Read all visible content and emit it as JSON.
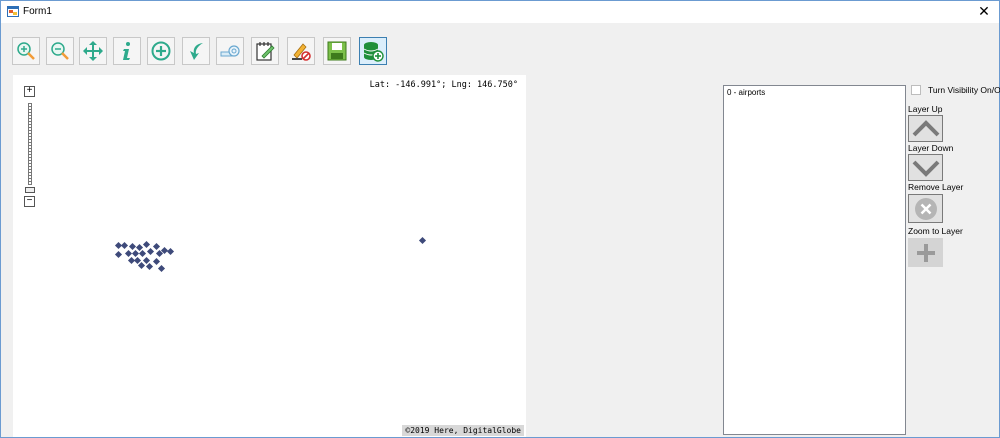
{
  "window": {
    "title": "Form1",
    "close_glyph": "✕"
  },
  "toolbar": {
    "buttons": [
      {
        "name": "zoom-in-icon"
      },
      {
        "name": "zoom-out-icon"
      },
      {
        "name": "pan-icon"
      },
      {
        "name": "info-icon"
      },
      {
        "name": "add-circle-icon"
      },
      {
        "name": "back-arrow-icon"
      },
      {
        "name": "measure-icon"
      },
      {
        "name": "edit-icon"
      },
      {
        "name": "clear-icon"
      },
      {
        "name": "save-icon"
      },
      {
        "name": "add-database-icon"
      }
    ]
  },
  "map": {
    "coordinates": "Lat: -146.991°; Lng: 146.750°",
    "attribution": "©2019 Here, DigitalGlobe",
    "zoom_in_glyph": "+",
    "zoom_out_glyph": "−",
    "marker_color": "#3e4a7a"
  },
  "layers": {
    "items": [
      "0 - airports"
    ],
    "visibility_label": "Turn Visibility On/Off",
    "visibility_checked": false,
    "layer_up_label": "Layer Up",
    "layer_down_label": "Layer Down",
    "remove_layer_label": "Remove Layer",
    "zoom_to_layer_label": "Zoom to Layer"
  },
  "colors": {
    "accent": "#2eaa8c",
    "selected_border": "#3c7fb1"
  }
}
